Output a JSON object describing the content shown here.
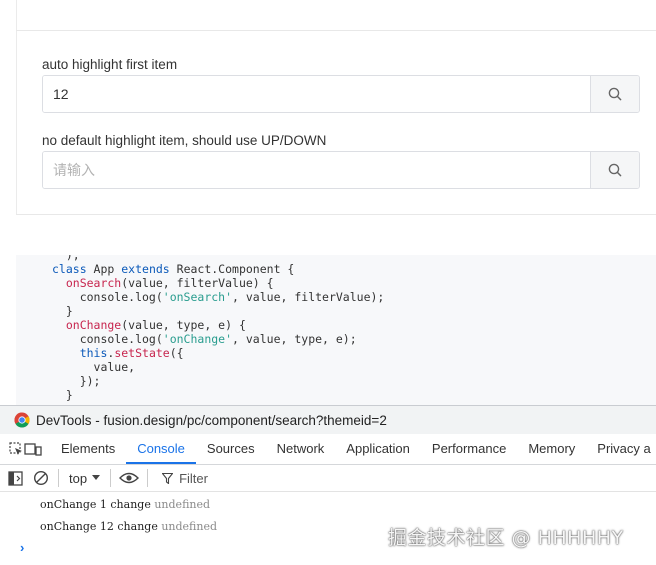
{
  "demo": {
    "example1": {
      "label": "auto highlight first item",
      "value": "12",
      "placeholder": "请输入"
    },
    "example2": {
      "label": "no default highlight item, should use UP/DOWN",
      "value": "",
      "placeholder": "请输入"
    }
  },
  "code": {
    "l0": "  ),",
    "l1": {
      "kw1": "class",
      "t1": " App ",
      "kw2": "extends",
      "t2": " React.Component {"
    },
    "l2": {
      "fn": "  onSearch",
      "t": "(value, filterValue) {"
    },
    "l3": {
      "t1": "    console.log(",
      "s": "'onSearch'",
      "t2": ", value, filterValue);"
    },
    "l4": "  }",
    "l5": {
      "fn": "  onChange",
      "t": "(value, type, e) {"
    },
    "l6": {
      "t1": "    console.log(",
      "s": "'onChange'",
      "t2": ", value, type, e);"
    },
    "l7": {
      "kw": "    this",
      "t1": ".",
      "p": "setState",
      "t2": "({"
    },
    "l8": "      value,",
    "l9": "    });",
    "l10": "  }"
  },
  "devtools": {
    "title": "DevTools - fusion.design/pc/component/search?themeid=2",
    "tabs": [
      "Elements",
      "Console",
      "Sources",
      "Network",
      "Application",
      "Performance",
      "Memory",
      "Privacy a"
    ],
    "active_tab": "Console",
    "context": "top",
    "filter_label": "Filter",
    "logs": [
      {
        "text": "onChange 1 change ",
        "undef": "undefined"
      },
      {
        "text": "onChange 12 change ",
        "undef": "undefined"
      }
    ],
    "prompt": "›"
  },
  "watermark": "掘金技术社区 @ HHHHHY",
  "colors": {
    "accent": "#1a73e8",
    "keyword": "#0b59b9",
    "string": "#2a9d8f",
    "function": "#c7254e"
  }
}
